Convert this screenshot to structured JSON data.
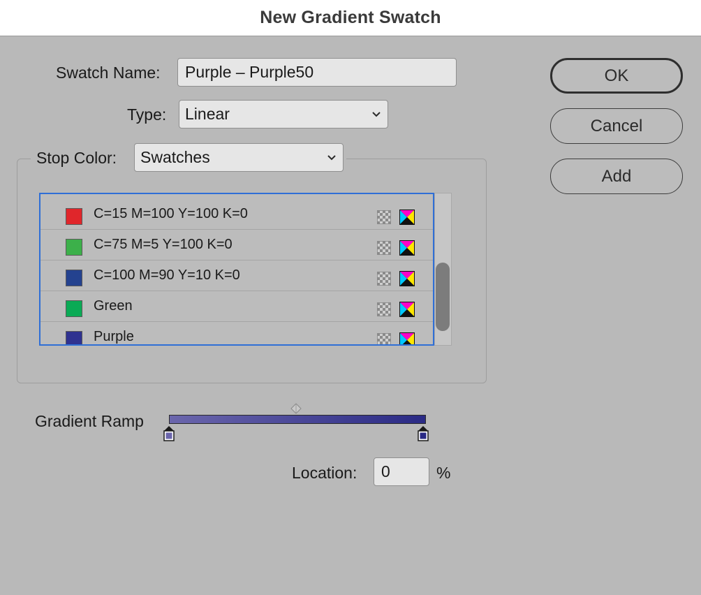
{
  "window": {
    "title": "New Gradient Swatch"
  },
  "form": {
    "swatch_name_label": "Swatch Name:",
    "swatch_name_value": "Purple – Purple50",
    "type_label": "Type:",
    "type_value": "Linear",
    "stop_color_label": "Stop Color:",
    "stop_color_value": "Swatches"
  },
  "buttons": {
    "ok": "OK",
    "cancel": "Cancel",
    "add": "Add"
  },
  "swatches": [
    {
      "name": "C=15 M=100 Y=100 K=0",
      "color": "#e0262b",
      "type_icon": "process-color-icon",
      "mode_icon": "cmyk-icon"
    },
    {
      "name": "C=75 M=5 Y=100 K=0",
      "color": "#3cb04a",
      "type_icon": "process-color-icon",
      "mode_icon": "cmyk-icon"
    },
    {
      "name": "C=100 M=90 Y=10 K=0",
      "color": "#24428f",
      "type_icon": "process-color-icon",
      "mode_icon": "cmyk-icon"
    },
    {
      "name": "Green",
      "color": "#0aaa55",
      "type_icon": "process-color-icon",
      "mode_icon": "cmyk-icon"
    },
    {
      "name": "Purple",
      "color": "#2f3290",
      "type_icon": "process-color-icon",
      "mode_icon": "cmyk-icon"
    }
  ],
  "gradient": {
    "ramp_label": "Gradient Ramp",
    "start_color": "#6b66ac",
    "end_color": "#2a2a85",
    "location_label": "Location:",
    "location_value": "0",
    "percent_sign": "%"
  },
  "colors": {
    "dialog_bg": "#b9b9b9",
    "focus_ring": "#2f6fd6"
  }
}
